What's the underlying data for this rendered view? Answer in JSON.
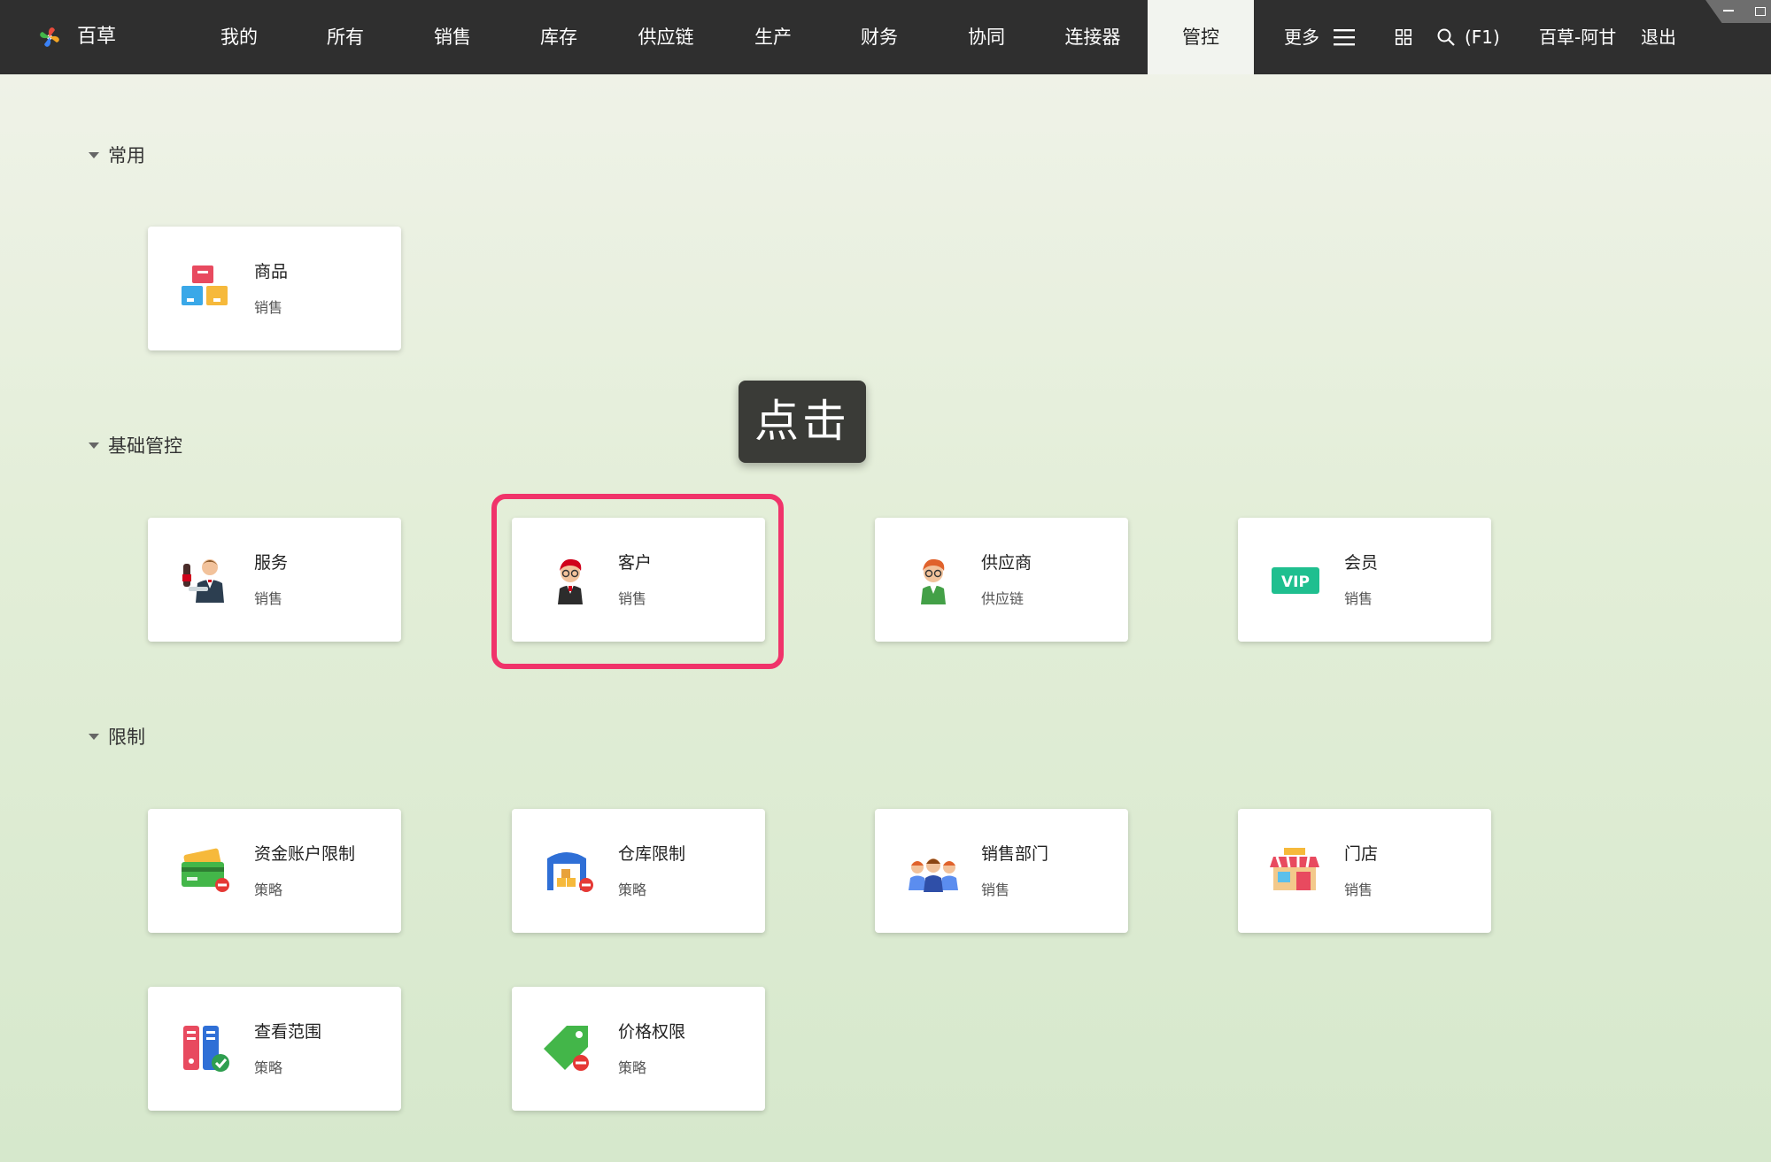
{
  "header": {
    "brand": "百草",
    "nav": [
      "我的",
      "所有",
      "销售",
      "库存",
      "供应链",
      "生产",
      "财务",
      "协同",
      "连接器",
      "管控"
    ],
    "active_nav": "管控",
    "more_label": "更多",
    "search_shortcut": "(F1)",
    "user": "百草-阿甘",
    "logout": "退出"
  },
  "sections": {
    "common": {
      "title": "常用",
      "cards": [
        {
          "title": "商品",
          "subtitle": "销售",
          "icon": "products-icon"
        }
      ]
    },
    "basic": {
      "title": "基础管控",
      "cards": [
        {
          "title": "服务",
          "subtitle": "销售",
          "icon": "service-icon"
        },
        {
          "title": "客户",
          "subtitle": "销售",
          "icon": "customer-icon"
        },
        {
          "title": "供应商",
          "subtitle": "供应链",
          "icon": "supplier-icon"
        },
        {
          "title": "会员",
          "subtitle": "销售",
          "icon": "vip-icon",
          "badge": "VIP"
        }
      ]
    },
    "restrict": {
      "title": "限制",
      "cards": [
        {
          "title": "资金账户限制",
          "subtitle": "策略",
          "icon": "fund-account-icon"
        },
        {
          "title": "仓库限制",
          "subtitle": "策略",
          "icon": "warehouse-icon"
        },
        {
          "title": "销售部门",
          "subtitle": "销售",
          "icon": "sales-team-icon"
        },
        {
          "title": "门店",
          "subtitle": "销售",
          "icon": "store-icon"
        },
        {
          "title": "查看范围",
          "subtitle": "策略",
          "icon": "view-scope-icon"
        },
        {
          "title": "价格权限",
          "subtitle": "策略",
          "icon": "price-tag-icon"
        }
      ]
    }
  },
  "annotation": {
    "tooltip": "点击",
    "color": "#f0336a"
  },
  "colors": {
    "topbar": "#2f2f2f",
    "accent_highlight": "#f0336a",
    "vip_green": "#1fbf8f"
  }
}
